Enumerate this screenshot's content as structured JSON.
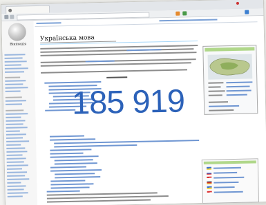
{
  "article": {
    "title": "Українська мова"
  },
  "sidebar": {
    "logo_text": "Вікіпедія"
  },
  "overlay": {
    "article_count": "185 919"
  },
  "colors": {
    "counter": "#2c62b9",
    "link": "#3366cc",
    "infobox_header": "#b0d78a"
  }
}
